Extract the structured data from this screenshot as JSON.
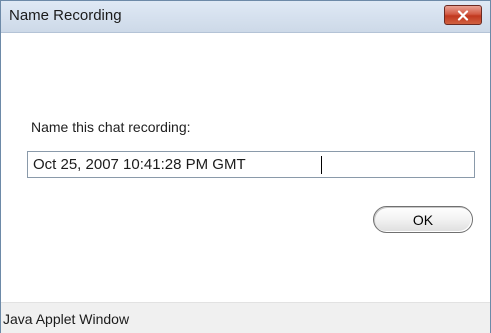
{
  "window": {
    "title": "Name Recording",
    "close_icon": "close-icon"
  },
  "dialog": {
    "prompt_label": "Name this chat recording:",
    "recording_name_value": "Oct 25, 2007 10:41:28 PM GMT",
    "ok_label": "OK"
  },
  "statusbar": {
    "text": "Java Applet Window"
  },
  "colors": {
    "titlebar": "#cdd9e8",
    "close_button": "#c1381f",
    "statusbar": "#f0f0f0"
  }
}
